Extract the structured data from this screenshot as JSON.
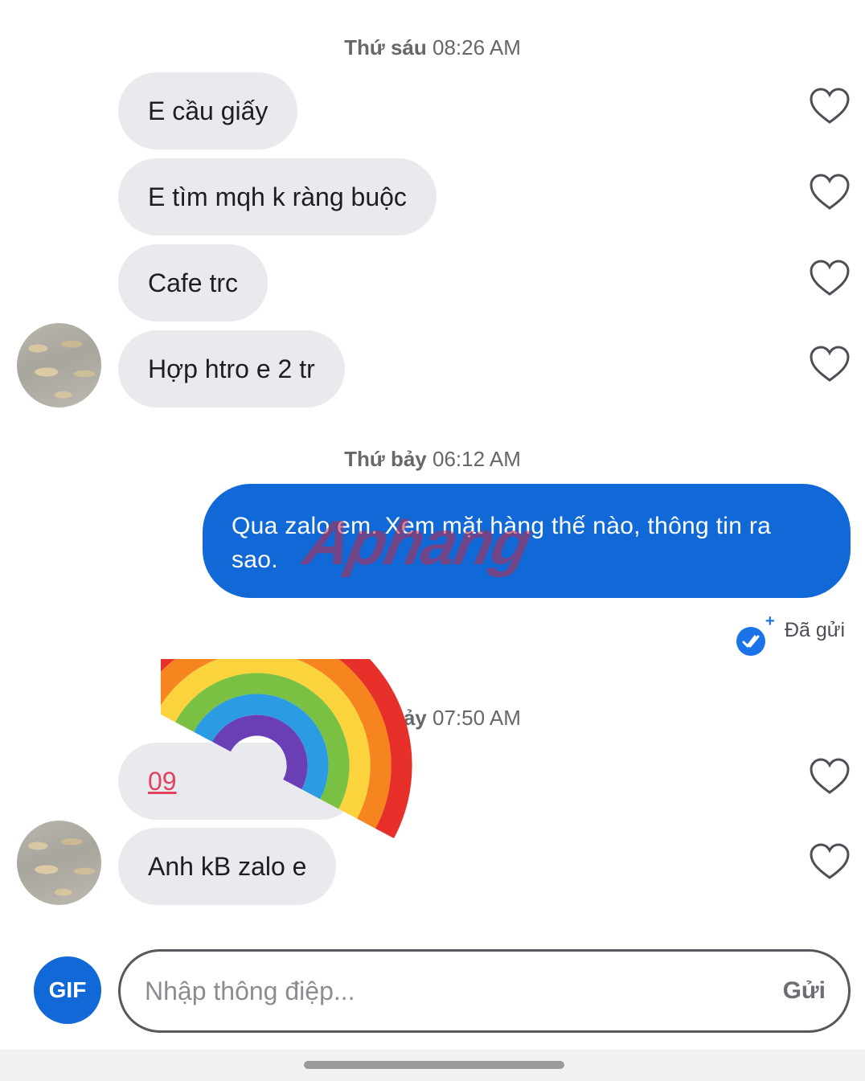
{
  "groups": [
    {
      "day": "Thứ sáu",
      "time": "08:26 AM"
    },
    {
      "day": "Thứ bảy",
      "time": "06:12 AM"
    },
    {
      "day": "Thứ bảy",
      "time": "07:50 AM"
    }
  ],
  "incoming_1": [
    "E cầu giấy",
    "E tìm mqh k ràng buộc",
    "Cafe trc",
    "Hợp htro e 2 tr"
  ],
  "outgoing": {
    "text": "Qua zalo em. Xem mặt hàng thế nào, thông tin ra sao.",
    "status": "Đã gửi"
  },
  "incoming_2": [
    "09",
    "Anh kB zalo e"
  ],
  "watermark": "Aphang",
  "composer": {
    "gif_label": "GIF",
    "placeholder": "Nhập thông điệp...",
    "send_label": "Gửi"
  },
  "colors": {
    "incoming_bubble": "#e9eaee",
    "outgoing_bubble": "#1169d8",
    "link": "#e4405f",
    "accent": "#1a73e8"
  },
  "icons": [
    "heart-icon",
    "read-check-icon",
    "gif-icon"
  ]
}
